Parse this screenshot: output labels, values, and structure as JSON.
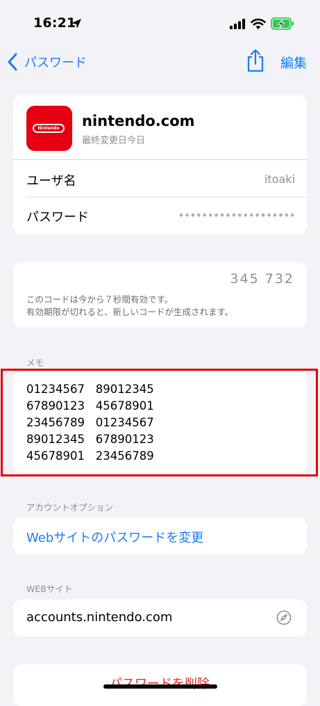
{
  "status_bar": {
    "time": "16:21"
  },
  "nav": {
    "back_label": "パスワード",
    "edit_label": "編集"
  },
  "account": {
    "site_title": "nintendo.com",
    "logo_text": "Nintendo",
    "last_modified": "最終変更日今日",
    "username_label": "ユーザ名",
    "username_value": "itoaki",
    "password_label": "パスワード",
    "password_value": "••••••••••••••••••••"
  },
  "verification": {
    "code": "345 732",
    "note_line1": "このコードは今から７秒間有効です。",
    "note_line2": "有効期限が切れると、新しいコードが生成されます。"
  },
  "memo": {
    "section_label": "メモ",
    "text": "01234567   89012345\n67890123   45678901\n23456789   01234567\n89012345   67890123\n45678901   23456789"
  },
  "account_options": {
    "section_label": "アカウントオプション",
    "change_password_link": "Webサイトのパスワードを変更"
  },
  "website": {
    "section_label": "WEBサイト",
    "url": "accounts.nintendo.com"
  },
  "actions": {
    "delete_label": "パスワードを削除"
  },
  "colors": {
    "accent": "#1a7cf3",
    "destructive": "#e5231b",
    "highlight": "#e30000",
    "logo_bg": "#e50012"
  }
}
